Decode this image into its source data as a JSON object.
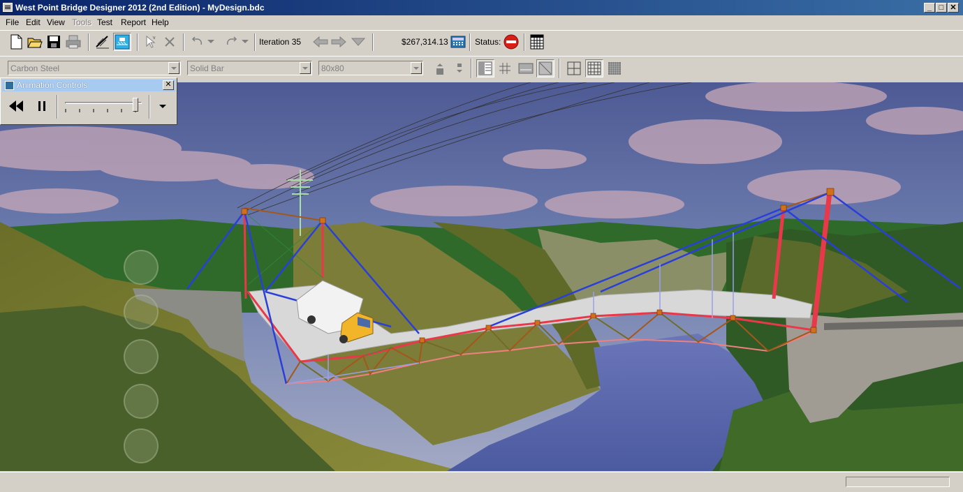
{
  "window": {
    "title": "West Point Bridge Designer 2012 (2nd Edition) - MyDesign.bdc",
    "minimize_label": "_",
    "maximize_label": "□",
    "close_label": "✕"
  },
  "menu": {
    "file": "File",
    "edit": "Edit",
    "view": "View",
    "tools": "Tools",
    "test": "Test",
    "report": "Report",
    "help": "Help"
  },
  "toolbar": {
    "iteration_label": "Iteration 35",
    "cost": "$267,314.13",
    "status_label": "Status:"
  },
  "member_properties": {
    "material": "Carbon Steel",
    "section": "Solid Bar",
    "size": "80x80"
  },
  "animation_controls": {
    "title": "Animation Controls",
    "close_label": "✕",
    "speed_fraction": 0.92
  },
  "colors": {
    "compression": "#e8394a",
    "tension": "#2a3fd8",
    "status_fail": "#d91e18",
    "title_active": "#0a246a"
  },
  "icons": {
    "status": "no-entry-icon",
    "rewind": "rewind-icon",
    "pause": "pause-icon"
  }
}
